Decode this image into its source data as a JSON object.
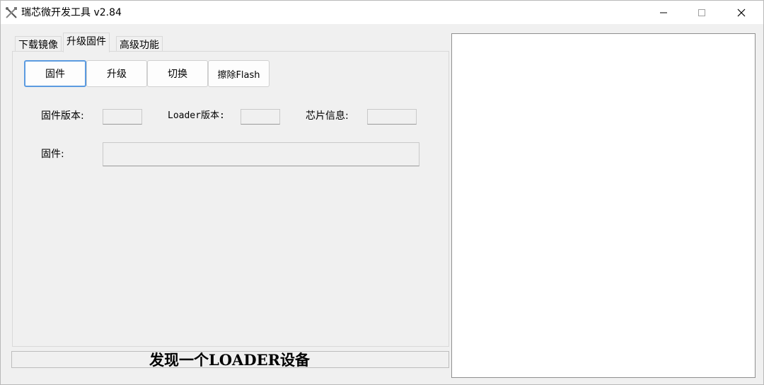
{
  "window": {
    "title": "瑞芯微开发工具 v2.84",
    "app_icon": "tools-icon",
    "controls": {
      "minimize": "—",
      "maximize": "☐",
      "close": "✕"
    }
  },
  "tabs": [
    {
      "label": "下载镜像",
      "active": false
    },
    {
      "label": "升级固件",
      "active": true
    },
    {
      "label": "高级功能",
      "active": false
    }
  ],
  "toolbar": {
    "firmware": "固件",
    "upgrade": "升级",
    "switch": "切换",
    "erase_flash": "擦除Flash"
  },
  "fields": {
    "firmware_version_label": "固件版本:",
    "firmware_version_value": "",
    "loader_version_label": "Loader版本:",
    "loader_version_value": "",
    "chip_info_label": "芯片信息:",
    "chip_info_value": "",
    "firmware_path_label": "固件:",
    "firmware_path_value": ""
  },
  "status": {
    "text": "发现一个LOADER设备"
  },
  "colors": {
    "accent_border": "#5b9be0",
    "title_bar": "#ffffff",
    "window_bg": "#f0f0f0"
  }
}
